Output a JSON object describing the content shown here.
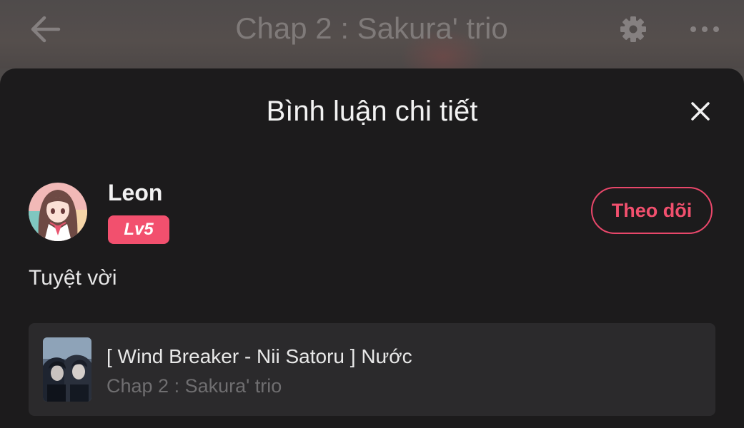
{
  "header": {
    "title": "Chap 2 : Sakura' trio",
    "back_icon": "arrow-left-icon",
    "settings_icon": "gear-icon",
    "more_icon": "more-dots-icon"
  },
  "sheet": {
    "title": "Bình luận chi tiết",
    "close_icon": "close-icon"
  },
  "comment": {
    "user": {
      "name": "Leon",
      "level": "Lv5",
      "avatar": "anime-girl-avatar"
    },
    "follow_label": "Theo dõi",
    "text": "Tuyệt vời"
  },
  "story": {
    "title": "[ Wind Breaker - Nii Satoru ] Nước",
    "chapter": "Chap 2 : Sakura' trio",
    "cover": "manga-cover-thumbnail"
  },
  "colors": {
    "sheet_bg": "#1c1b1c",
    "card_bg": "#2b2a2c",
    "accent": "#f2506e",
    "dim_header_text": "#7f7a79"
  }
}
